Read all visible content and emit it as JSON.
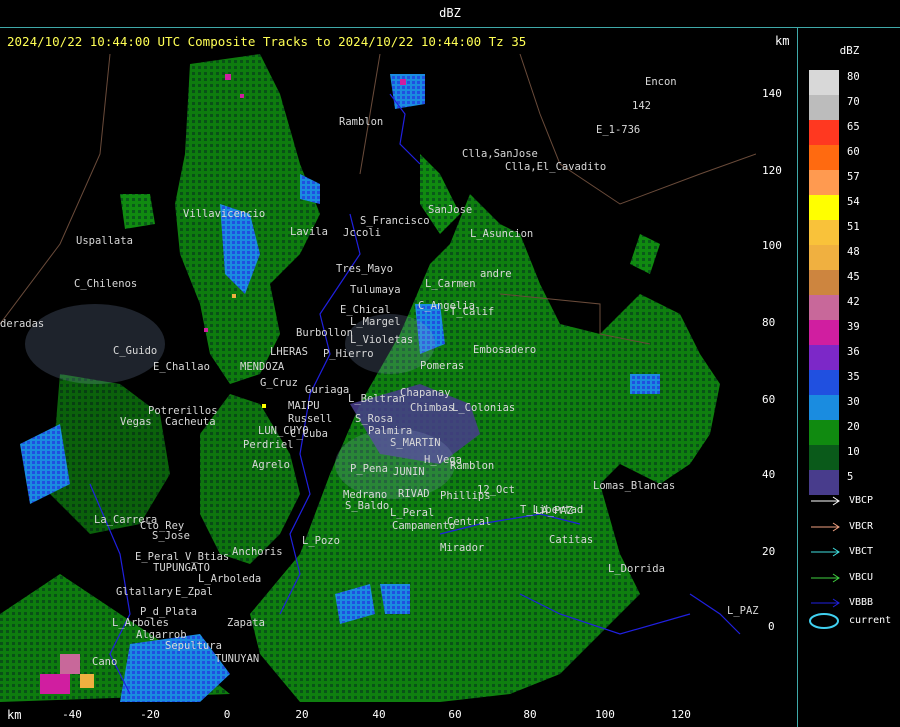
{
  "window": {
    "title": "dBZ"
  },
  "header": {
    "text": "2024/10/22 10:44:00 UTC Composite Tracks to 2024/10/22 10:44:00 Tz 35",
    "km_top": "km",
    "km_bottom": "km"
  },
  "axes": {
    "x_ticks": [
      "-40",
      "-20",
      "0",
      "20",
      "40",
      "60",
      "80",
      "100",
      "120"
    ],
    "y_ticks": [
      "140",
      "120",
      "100",
      "80",
      "60",
      "40",
      "20",
      "0"
    ]
  },
  "legend": {
    "title": "dBZ",
    "scale": [
      {
        "label": "80",
        "color": "#d8d8d8"
      },
      {
        "label": "70",
        "color": "#bcbcbc"
      },
      {
        "label": "65",
        "color": "#ff3820"
      },
      {
        "label": "60",
        "color": "#ff6a10"
      },
      {
        "label": "57",
        "color": "#ff9a50"
      },
      {
        "label": "54",
        "color": "#ffff00"
      },
      {
        "label": "51",
        "color": "#f9c23a"
      },
      {
        "label": "48",
        "color": "#f0b040"
      },
      {
        "label": "45",
        "color": "#cd853f"
      },
      {
        "label": "42",
        "color": "#c8689a"
      },
      {
        "label": "39",
        "color": "#d01ea0"
      },
      {
        "label": "36",
        "color": "#7c28c8"
      },
      {
        "label": "35",
        "color": "#2050e0"
      },
      {
        "label": "30",
        "color": "#1a8ce0"
      },
      {
        "label": "20",
        "color": "#108a10"
      },
      {
        "label": "10",
        "color": "#0a5a1a"
      },
      {
        "label": "5",
        "color": "#483c8c"
      }
    ],
    "tracks": [
      {
        "label": "VBCP",
        "color": "#ffffff"
      },
      {
        "label": "VBCR",
        "color": "#f0a080"
      },
      {
        "label": "VBCT",
        "color": "#40e0e0"
      },
      {
        "label": "VBCU",
        "color": "#40d040"
      },
      {
        "label": "VBBB",
        "color": "#2020e0"
      }
    ],
    "current_label": "current",
    "current_color": "#40d0f0"
  },
  "places": [
    {
      "id": "p-encon",
      "name": "Encon"
    },
    {
      "id": "p-e1736",
      "name": "E_1-736"
    },
    {
      "id": "p-142",
      "name": "142"
    },
    {
      "id": "p-ramblon1",
      "name": "Ramblon"
    },
    {
      "id": "p-clla-sanjose",
      "name": "Clla,SanJose"
    },
    {
      "id": "p-clla-cavadito",
      "name": "Clla,El_Cavadito"
    },
    {
      "id": "p-sanjose",
      "name": "SanJose"
    },
    {
      "id": "p-sfrancisco",
      "name": "S_Francisco"
    },
    {
      "id": "p-jccoli",
      "name": "Jccoli"
    },
    {
      "id": "p-lasuncion",
      "name": "L_Asuncion"
    },
    {
      "id": "p-uspallata",
      "name": "Uspallata"
    },
    {
      "id": "p-villavicencio",
      "name": "Villavicencio"
    },
    {
      "id": "p-lavila",
      "name": "Lavila"
    },
    {
      "id": "p-tresmayo",
      "name": "Tres_Mayo"
    },
    {
      "id": "p-tulumaya",
      "name": "Tulumaya"
    },
    {
      "id": "p-lcarmen",
      "name": "L_Carmen"
    },
    {
      "id": "p-andre",
      "name": "andre"
    },
    {
      "id": "p-cchilenos",
      "name": "C_Chilenos"
    },
    {
      "id": "p-echical",
      "name": "E_Chical"
    },
    {
      "id": "p-cangelia",
      "name": "C_Angelia"
    },
    {
      "id": "p-lmargel",
      "name": "L_Margel"
    },
    {
      "id": "p-tcalif",
      "name": "T_Calif"
    },
    {
      "id": "p-burbollon",
      "name": "Burbollon"
    },
    {
      "id": "p-lvioletas",
      "name": "L_Violetas"
    },
    {
      "id": "p-deradas",
      "name": "deradas"
    },
    {
      "id": "p-cguido",
      "name": "C_Guido"
    },
    {
      "id": "p-lheras",
      "name": "LHERAS"
    },
    {
      "id": "p-phierro",
      "name": "P_Hierro"
    },
    {
      "id": "p-embosadero",
      "name": "Embosadero"
    },
    {
      "id": "p-echallao",
      "name": "E_Challao"
    },
    {
      "id": "p-mendoza",
      "name": "MENDOZA"
    },
    {
      "id": "p-pomeras",
      "name": "Pomeras"
    },
    {
      "id": "p-gcruz",
      "name": "G_Cruz"
    },
    {
      "id": "p-guriaga",
      "name": "Guriaga"
    },
    {
      "id": "p-chapanay",
      "name": "Chapanay"
    },
    {
      "id": "p-lbeltran",
      "name": "L_Beltran"
    },
    {
      "id": "p-potrerillos",
      "name": "Potrerillos"
    },
    {
      "id": "p-maipu",
      "name": "MAIPU"
    },
    {
      "id": "p-chimbas",
      "name": "Chimbas"
    },
    {
      "id": "p-lcolonias",
      "name": "L_Colonias"
    },
    {
      "id": "p-vegas",
      "name": "Vegas"
    },
    {
      "id": "p-cacheuta",
      "name": "Cacheuta"
    },
    {
      "id": "p-russell",
      "name": "Russell"
    },
    {
      "id": "p-srosa",
      "name": "S_Rosa"
    },
    {
      "id": "p-luncuyo",
      "name": "LUN_CUYO"
    },
    {
      "id": "p-palmira",
      "name": "Palmira"
    },
    {
      "id": "p-ccuba",
      "name": "C_Cuba"
    },
    {
      "id": "p-smartin",
      "name": "S_MARTIN"
    },
    {
      "id": "p-perdriel",
      "name": "Perdriel"
    },
    {
      "id": "p-hvega",
      "name": "H_Vega"
    },
    {
      "id": "p-ramblon2",
      "name": "Ramblon"
    },
    {
      "id": "p-agrelo",
      "name": "Agrelo"
    },
    {
      "id": "p-ppena",
      "name": "P_Pena"
    },
    {
      "id": "p-junin",
      "name": "JUNIN"
    },
    {
      "id": "p-lomasblancas",
      "name": "Lomas_Blancas"
    },
    {
      "id": "p-12oct",
      "name": "12_Oct"
    },
    {
      "id": "p-medrano",
      "name": "Medrano"
    },
    {
      "id": "p-rivad",
      "name": "RIVAD"
    },
    {
      "id": "p-phillips",
      "name": "Phillips"
    },
    {
      "id": "p-sbaldo",
      "name": "S_Baldo"
    },
    {
      "id": "p-lperal",
      "name": "L_Peral"
    },
    {
      "id": "p-tlibertad",
      "name": "T_Libertad"
    },
    {
      "id": "p-lapaz",
      "name": "LA_PAZ"
    },
    {
      "id": "p-lacarrera",
      "name": "La_Carrera"
    },
    {
      "id": "p-ctorey",
      "name": "Cto_Rey"
    },
    {
      "id": "p-campamento",
      "name": "Campamento"
    },
    {
      "id": "p-central",
      "name": "Central"
    },
    {
      "id": "p-catitas",
      "name": "Catitas"
    },
    {
      "id": "p-sjose",
      "name": "S_Jose"
    },
    {
      "id": "p-lpozo",
      "name": "L_Pozo"
    },
    {
      "id": "p-mirador",
      "name": "Mirador"
    },
    {
      "id": "p-eperal",
      "name": "E_Peral"
    },
    {
      "id": "p-vbtias",
      "name": "V_Btias"
    },
    {
      "id": "p-anchoris",
      "name": "Anchoris"
    },
    {
      "id": "p-tupungato",
      "name": "TUPUNGATO"
    },
    {
      "id": "p-larboleda",
      "name": "L_Arboleda"
    },
    {
      "id": "p-ldorrida",
      "name": "L_Dorrida"
    },
    {
      "id": "p-gltallary",
      "name": "Gltallary"
    },
    {
      "id": "p-ezpal",
      "name": "E_Zpal"
    },
    {
      "id": "p-lpaz",
      "name": "L_PAZ"
    },
    {
      "id": "p-pdplata",
      "name": "P_d_Plata"
    },
    {
      "id": "p-larboles",
      "name": "L_Arboles"
    },
    {
      "id": "p-zapata",
      "name": "Zapata"
    },
    {
      "id": "p-algarrob",
      "name": "Algarrob"
    },
    {
      "id": "p-sepultura",
      "name": "Sepultura"
    },
    {
      "id": "p-tunuyan",
      "name": "TUNUYAN"
    },
    {
      "id": "p-cano",
      "name": "Cano"
    }
  ]
}
